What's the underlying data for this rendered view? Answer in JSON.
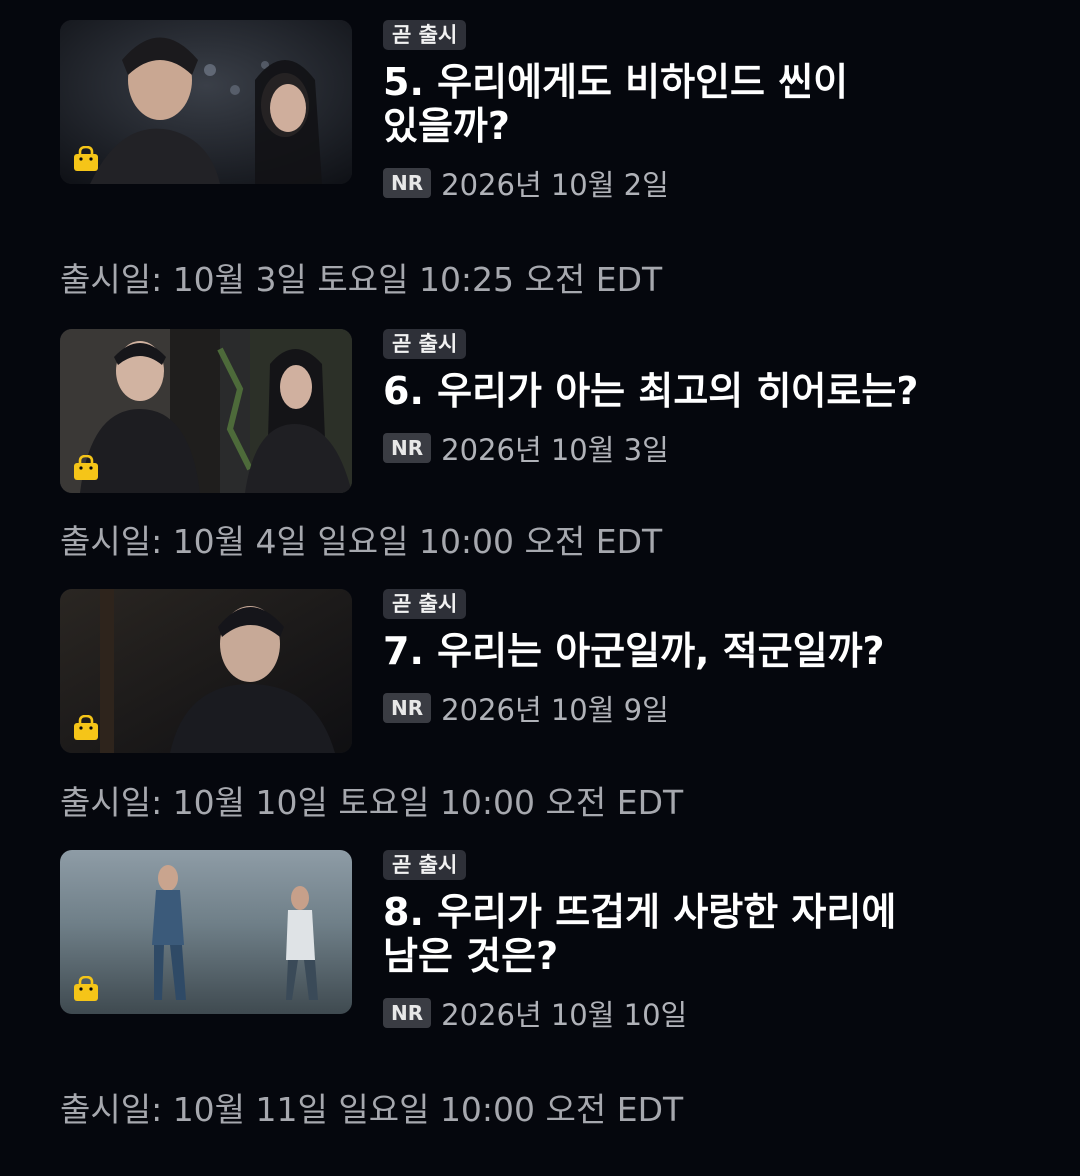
{
  "colors": {
    "background": "#05070d",
    "badge_bg": "#2e3038",
    "bag_icon": "#f5c518",
    "muted_text": "#a6a8ae"
  },
  "episodes": [
    {
      "badge": "곧 출시",
      "title": "5. 우리에게도 비하인드 씬이 있을까?",
      "rating": "NR",
      "date": "2026년 10월 2일",
      "release": "출시일: 10월 3일 토요일 10:25 오전 EDT",
      "thumbnail_icon": "shopping-bag-icon"
    },
    {
      "badge": "곧 출시",
      "title": "6. 우리가 아는 최고의 히어로는?",
      "rating": "NR",
      "date": "2026년 10월 3일",
      "release": "출시일: 10월 4일 일요일 10:00 오전 EDT",
      "thumbnail_icon": "shopping-bag-icon"
    },
    {
      "badge": "곧 출시",
      "title": "7. 우리는 아군일까, 적군일까?",
      "rating": "NR",
      "date": "2026년 10월 9일",
      "release": "출시일: 10월 10일 토요일 10:00 오전 EDT",
      "thumbnail_icon": "shopping-bag-icon"
    },
    {
      "badge": "곧 출시",
      "title": "8. 우리가 뜨겁게 사랑한 자리에 남은 것은?",
      "rating": "NR",
      "date": "2026년 10월 10일",
      "release": "출시일: 10월 11일 일요일 10:00 오전 EDT",
      "thumbnail_icon": "shopping-bag-icon"
    }
  ]
}
